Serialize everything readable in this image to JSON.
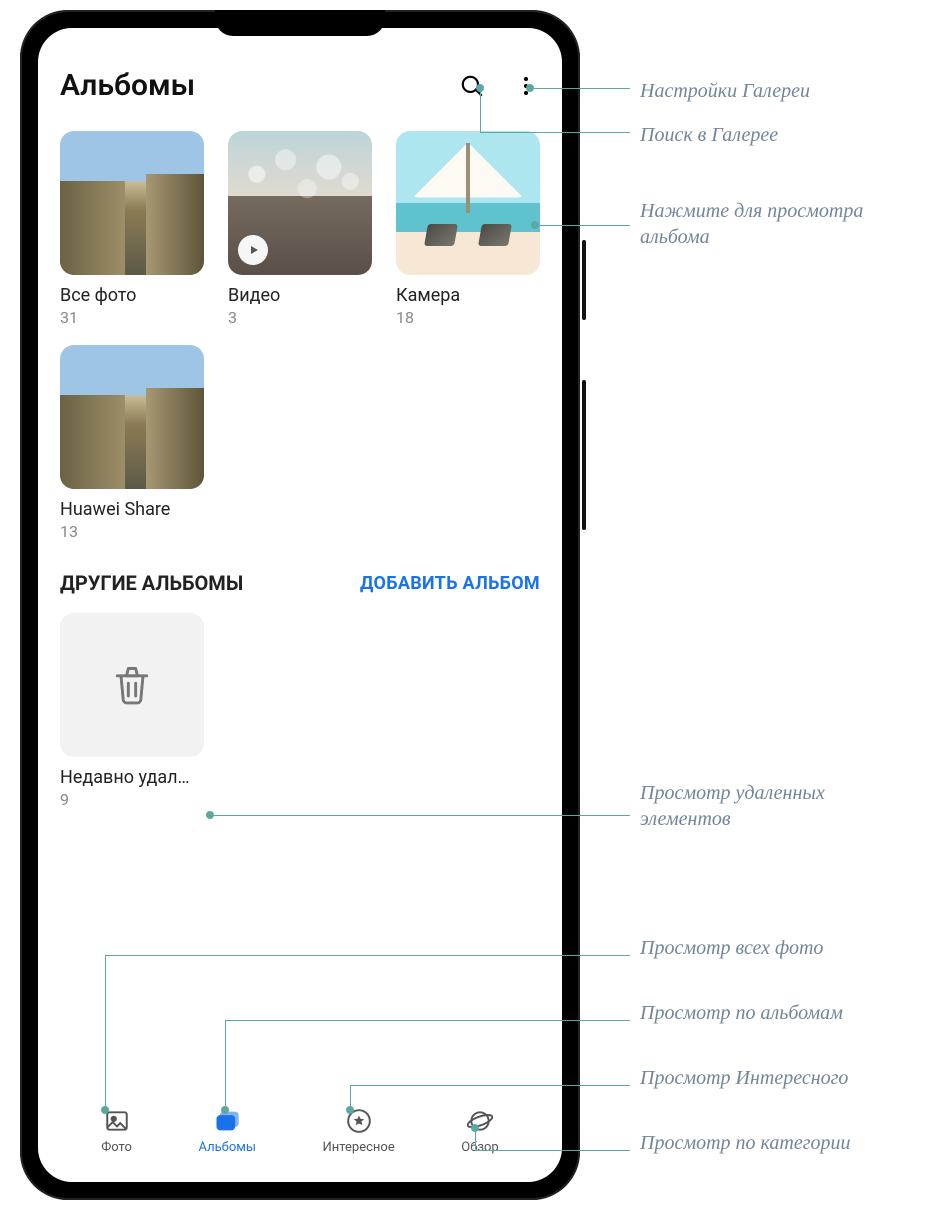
{
  "header": {
    "title": "Альбомы"
  },
  "albums": [
    {
      "name": "Все фото",
      "count": "31"
    },
    {
      "name": "Видео",
      "count": "3"
    },
    {
      "name": "Камера",
      "count": "18"
    },
    {
      "name": "Huawei Share",
      "count": "13"
    }
  ],
  "section": {
    "title": "ДРУГИЕ АЛЬБОМЫ",
    "add_label": "ДОБАВИТЬ АЛЬБОМ"
  },
  "other_albums": [
    {
      "name": "Недавно удал…",
      "count": "9"
    }
  ],
  "nav": {
    "photos": "Фото",
    "albums": "Альбомы",
    "highlights": "Интересное",
    "discover": "Обзор"
  },
  "callouts": {
    "settings": "Настройки Галереи",
    "search": "Поиск в Галерее",
    "tap_album": "Нажмите для просмотра альбома",
    "deleted": "Просмотр удаленных элементов",
    "all_photos": "Просмотр всех фото",
    "by_albums": "Просмотр по альбомам",
    "highlights": "Просмотр Интересного",
    "by_category": "Просмотр по категории"
  }
}
